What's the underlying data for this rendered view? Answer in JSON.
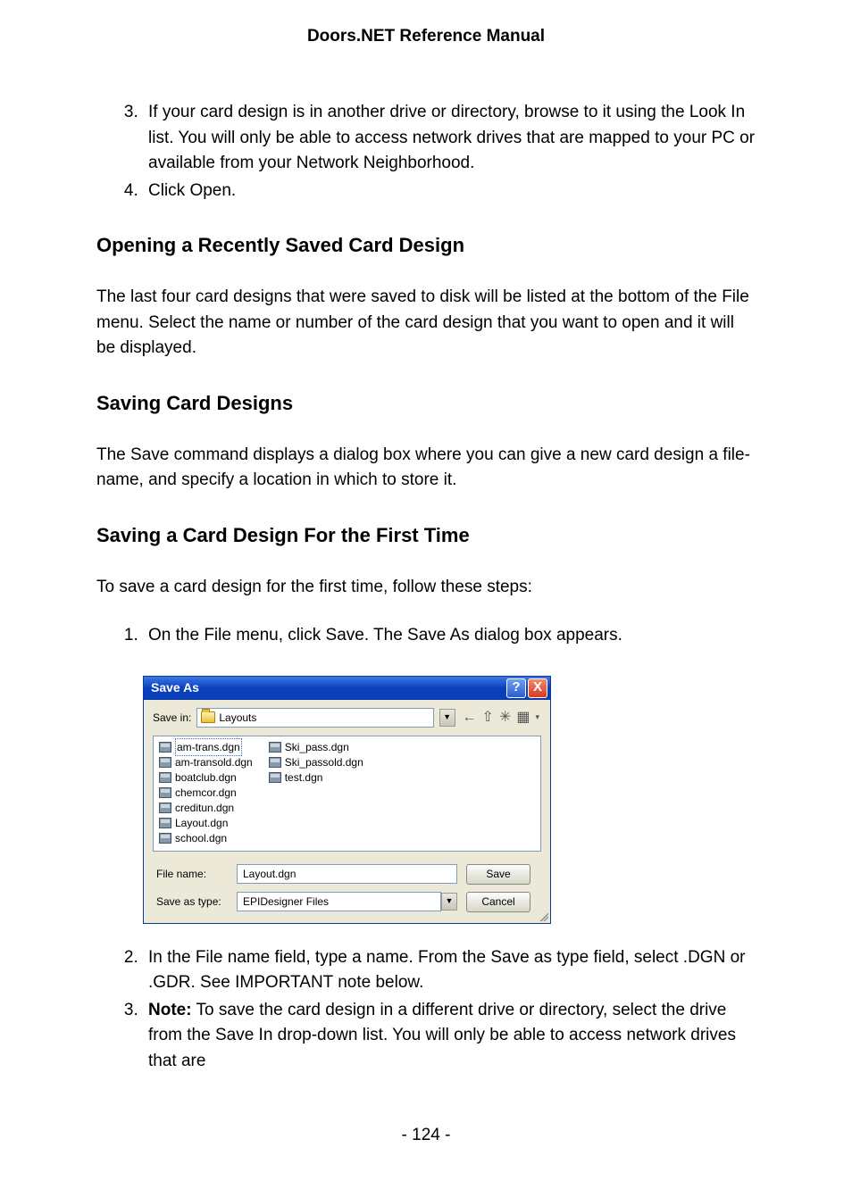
{
  "header": {
    "title": "Doors.NET Reference Manual"
  },
  "list1": {
    "start": 3,
    "items": [
      "If your card design is in another drive or directory, browse to it using the Look In list. You will only be able to access network drives that are mapped to your PC or available from your Network Neighborhood.",
      "Click Open."
    ]
  },
  "sec1": {
    "heading": "Opening a Recently Saved Card Design",
    "para": "The last four card designs that were saved to disk will be listed at the bottom of the File menu. Select the name or number of the card design that you want to open and it will be displayed."
  },
  "sec2": {
    "heading": "Saving Card Designs",
    "para": "The Save command displays a dialog box where you can give a new card design a file-name, and specify a location in which to store it."
  },
  "sec3": {
    "heading": "Saving a Card Design For the First Time",
    "para": "To save a card design for the first time, follow these steps:"
  },
  "list2": {
    "start": 1,
    "item1": "On the File menu, click Save. The Save As dialog box appears.",
    "item2": "In the File name field, type a name. From the Save as type field, select .DGN or .GDR. See IMPORTANT note below.",
    "item3_label": "Note:",
    "item3_rest": " To save the card design in a different drive or directory, select the drive from the Save In drop-down list. You will only be able to access network drives that are"
  },
  "dialog": {
    "title": "Save As",
    "help": "?",
    "close": "X",
    "save_in_label": "Save in:",
    "save_in_value": "Layouts",
    "toolbar_icons": {
      "back": "←",
      "up": "⇧",
      "newfolder": "✳",
      "views": "▦",
      "views_arrow": "▾"
    },
    "files": [
      "am-trans.dgn",
      "am-transold.dgn",
      "boatclub.dgn",
      "chemcor.dgn",
      "creditun.dgn",
      "Layout.dgn",
      "school.dgn",
      "Ski_pass.dgn",
      "Ski_passold.dgn",
      "test.dgn"
    ],
    "filename_label": "File name:",
    "filename_value": "Layout.dgn",
    "savetype_label": "Save as type:",
    "savetype_value": "EPIDesigner Files",
    "save_btn": "Save",
    "cancel_btn": "Cancel",
    "dd_arrow": "▼"
  },
  "footer": {
    "page": "- 124 -"
  }
}
